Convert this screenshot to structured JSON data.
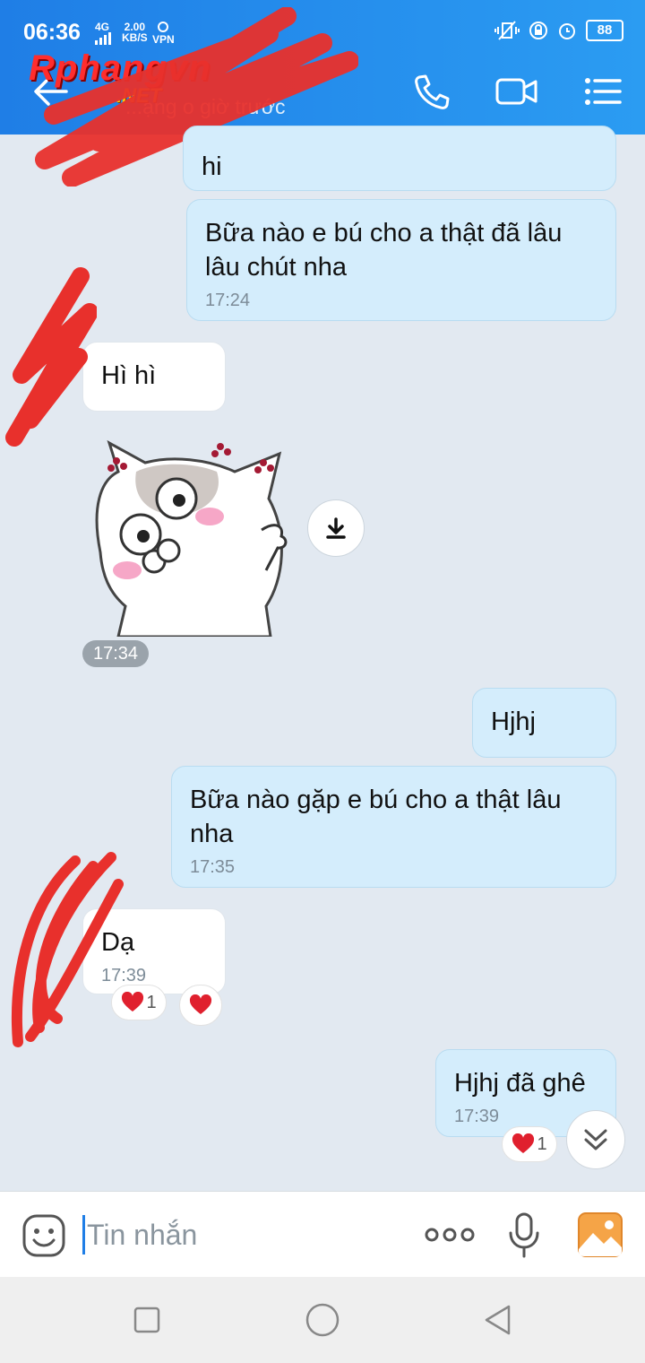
{
  "status_bar": {
    "time": "06:36",
    "network": "4G",
    "speed_value": "2.00",
    "speed_unit": "KB/S",
    "vpn": "VPN",
    "battery": "88"
  },
  "header": {
    "subtitle": "...ạng o giờ trước",
    "logo_main": "Rphangvn",
    "logo_sub": ".NET"
  },
  "messages": [
    {
      "side": "me",
      "text": "hi",
      "time": ""
    },
    {
      "side": "me",
      "text": "Bữa nào e bú cho a thật đã lâu lâu chút nha",
      "time": "17:24"
    },
    {
      "side": "other",
      "text": "Hì hì",
      "time": ""
    },
    {
      "side": "other",
      "type": "sticker",
      "time": "17:34"
    },
    {
      "side": "me",
      "text": "Hjhj",
      "time": ""
    },
    {
      "side": "me",
      "text": "Bữa nào gặp e bú cho a thật lâu nha",
      "time": "17:35"
    },
    {
      "side": "other",
      "text": "Dạ",
      "time": "17:39",
      "reaction_count": "1"
    },
    {
      "side": "me",
      "text": "Hjhj đã ghê",
      "time": "17:39",
      "reaction_count": "1"
    }
  ],
  "input": {
    "placeholder": "Tin nhắn"
  },
  "colors": {
    "header_start": "#1f7ee6",
    "header_end": "#2b9cf2",
    "me_bubble": "#d4edfc",
    "other_bubble": "#ffffff",
    "chat_bg": "#e2e9f1",
    "heart": "#e0202e"
  },
  "icons": {
    "back": "arrow-left-icon",
    "call": "phone-icon",
    "video": "video-camera-icon",
    "menu": "list-menu-icon",
    "download": "download-icon",
    "scroll": "double-chevron-down-icon",
    "emoji": "emoji-icon",
    "more": "more-dots-icon",
    "mic": "microphone-icon",
    "image": "image-icon"
  }
}
